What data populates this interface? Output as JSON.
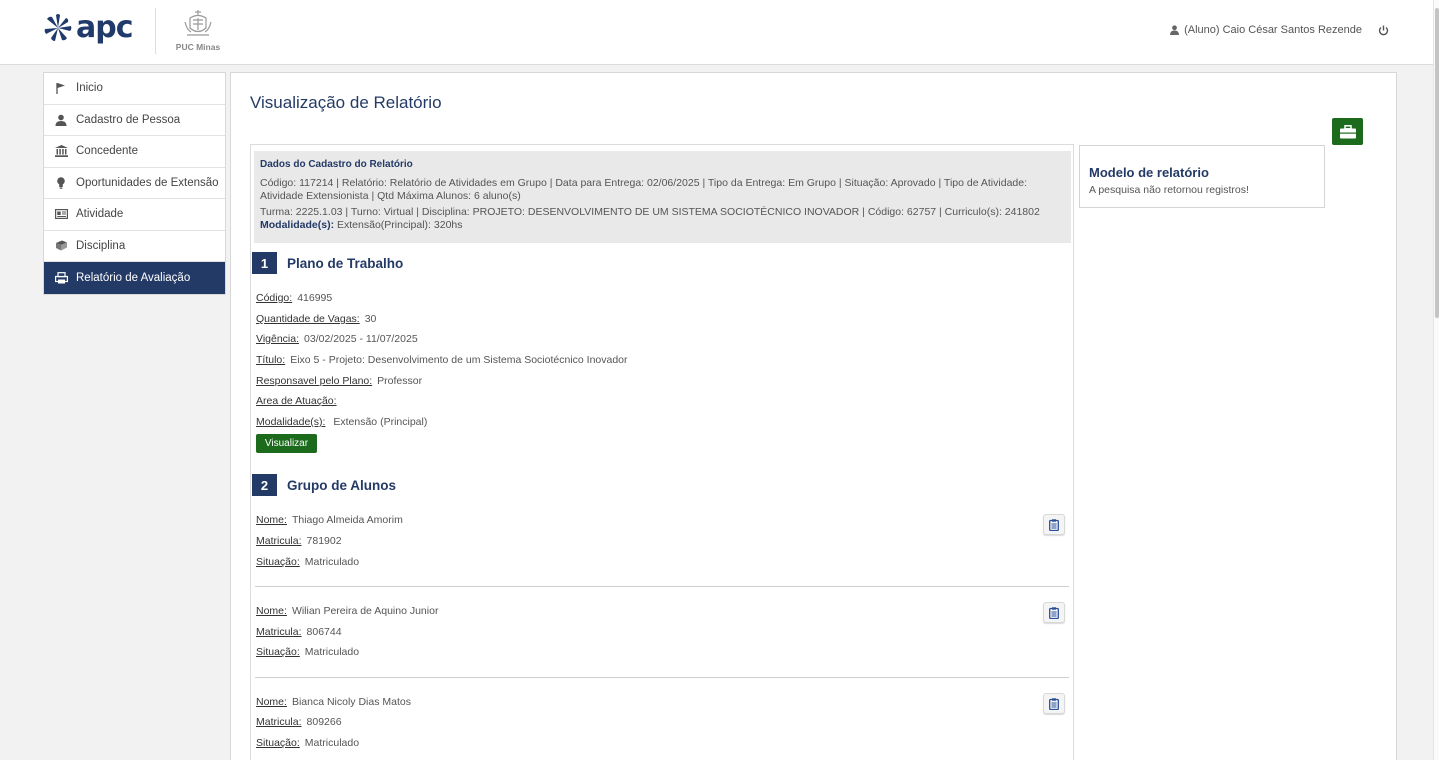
{
  "header": {
    "brand": "apc",
    "partner": "PUC Minas",
    "user": "(Aluno) Caio César Santos Rezende"
  },
  "sidebar": {
    "items": [
      {
        "label": "Inicio",
        "icon": "flag-icon"
      },
      {
        "label": "Cadastro de Pessoa",
        "icon": "person-icon"
      },
      {
        "label": "Concedente",
        "icon": "institution-icon"
      },
      {
        "label": "Oportunidades de Extensão",
        "icon": "lightbulb-icon"
      },
      {
        "label": "Atividade",
        "icon": "id-card-icon"
      },
      {
        "label": "Disciplina",
        "icon": "book-icon"
      },
      {
        "label": "Relatório de Avaliação",
        "icon": "printer-icon",
        "active": true
      }
    ]
  },
  "main": {
    "title": "Visualização de Relatório",
    "info": {
      "title": "Dados do Cadastro do Relatório",
      "line1": "Código: 117214    | Relatório: Relatório de Atividades em Grupo    | Data para Entrega: 02/06/2025    | Tipo da Entrega: Em Grupo    | Situação: Aprovado    | Tipo de Atividade: Atividade Extensionista    | Qtd Máxima Alunos: 6 aluno(s)",
      "line2": "Turma: 2225.1.03 | Turno: Virtual    | Disciplina: PROJETO: DESENVOLVIMENTO DE UM SISTEMA SOCIOTÉCNICO INOVADOR | Código: 62757    | Curriculo(s): 241802",
      "modalidade_label": "Modalidade(s):",
      "modalidade_value": " Extensão(Principal): 320hs"
    },
    "plano": {
      "number": "1",
      "title": "Plano de Trabalho",
      "fields": [
        {
          "label": "Código:",
          "value": "416995"
        },
        {
          "label": "Quantidade de Vagas:",
          "value": "30"
        },
        {
          "label": "Vigência:",
          "value": "03/02/2025 - 11/07/2025"
        },
        {
          "label": "Título:",
          "value": "Eixo 5 - Projeto: Desenvolvimento de um Sistema Sociotécnico Inovador"
        },
        {
          "label": "Responsavel pelo Plano:",
          "value": "Professor"
        },
        {
          "label": "Area de Atuação:",
          "value": ""
        },
        {
          "label": "Modalidade(s):",
          "value": " Extensão (Principal)"
        }
      ],
      "button": "Visualizar"
    },
    "grupo": {
      "number": "2",
      "title": "Grupo de Alunos",
      "labels": {
        "nome": "Nome:",
        "matricula": "Matricula:",
        "situacao": "Situação:"
      },
      "students": [
        {
          "nome": "Thiago Almeida Amorim",
          "matricula": "781902",
          "situacao": "Matriculado"
        },
        {
          "nome": "Wilian Pereira de Aquino Junior",
          "matricula": "806744",
          "situacao": "Matriculado"
        },
        {
          "nome": "Bianca Nicoly Dias Matos",
          "matricula": "809266",
          "situacao": "Matriculado"
        }
      ]
    },
    "modelo": {
      "title": "Modelo de relatório",
      "empty": "A pesquisa não retornou registros!"
    }
  },
  "colors": {
    "navy": "#243a66",
    "green": "#1c6b1c"
  }
}
